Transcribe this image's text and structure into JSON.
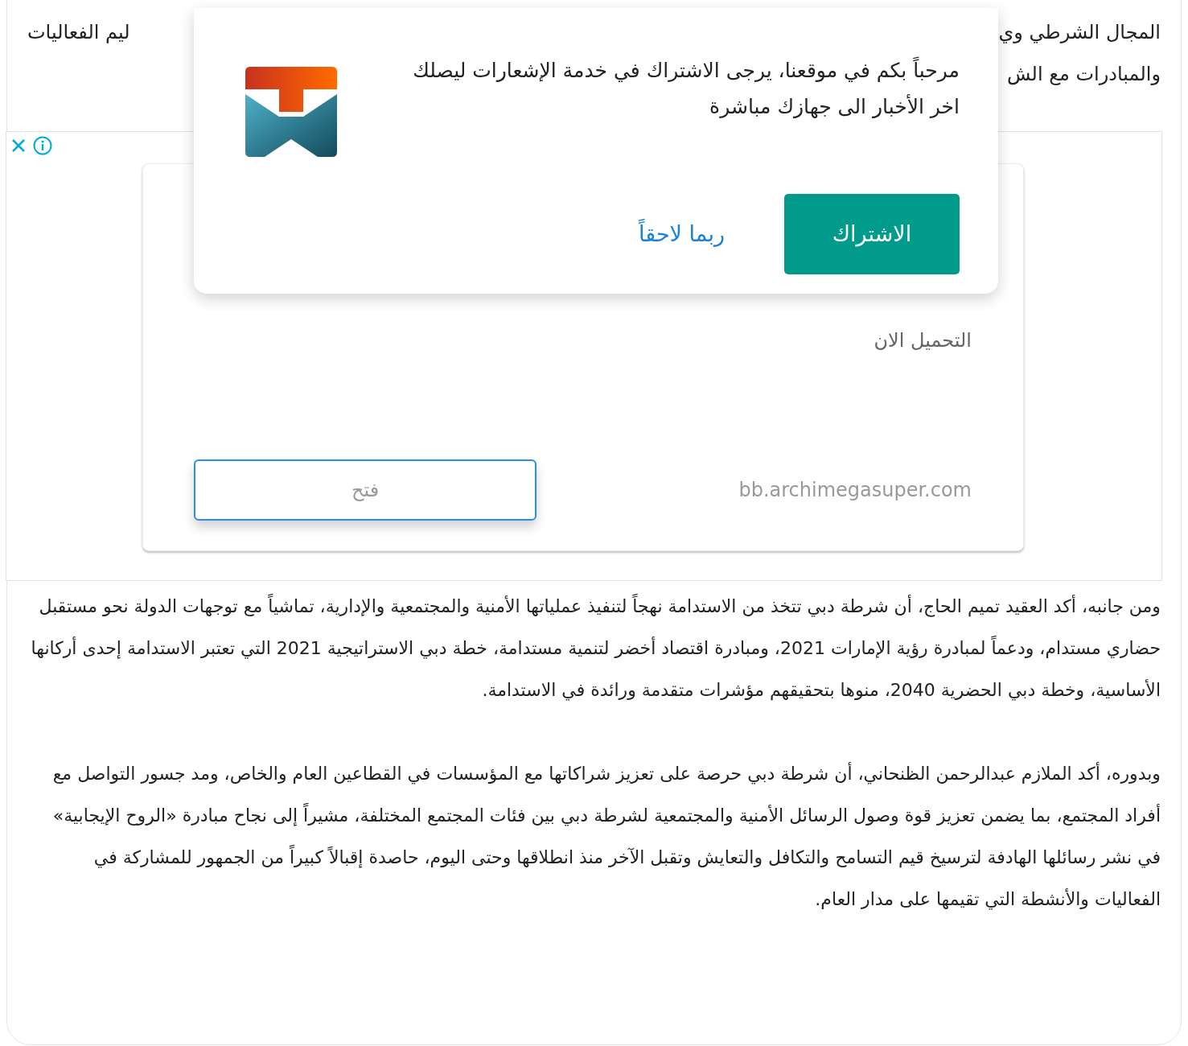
{
  "article_top": {
    "lines": [
      {
        "right": "المجال الشرطي وي",
        "left": "ليم الفعاليات"
      },
      {
        "right": "والمبادرات مع الش"
      }
    ]
  },
  "ad": {
    "headline": "التحميل الان",
    "domain": "bb.archimegasuper.com",
    "open_button": "فتح"
  },
  "popup": {
    "message": "مرحباً بكم في موقعنا، يرجى الاشتراك في خدمة الإشعارات ليصلك اخر الأخبار الى جهازك مباشرة",
    "subscribe_button": "الاشتراك",
    "later_button": "ربما لاحقاً"
  },
  "paragraphs": [
    "ومن جانبه، أكد العقيد تميم الحاج، أن شرطة دبي تتخذ من الاستدامة نهجاً لتنفيذ عملياتها الأمنية والمجتمعية والإدارية، تماشياً مع توجهات الدولة نحو مستقبل حضاري مستدام، ودعماً لمبادرة رؤية الإمارات 2021، ومبادرة اقتصاد أخضر لتنمية مستدامة، خطة دبي الاستراتيجية 2021 التي تعتبر الاستدامة إحدى أركانها الأساسية، وخطة دبي الحضرية 2040، منوها بتحقيقهم مؤشرات متقدمة ورائدة في الاستدامة.",
    "وبدوره، أكد الملازم عبدالرحمن الظنحاني، أن شرطة دبي حرصة على تعزيز شراكاتها مع المؤسسات في القطاعين العام والخاص، ومد جسور التواصل مع أفراد المجتمع، بما يضمن تعزيز قوة وصول الرسائل الأمنية والمجتمعية لشرطة دبي بين فئات المجتمع المختلفة، مشيراً إلى نجاح مبادرة «الروح الإيجابية» في نشر رسائلها الهادفة لترسيخ قيم التسامح والتكافل والتعايش وتقبل الآخر منذ انطلاقها وحتى اليوم، حاصدة إقبالاً كبيراً من الجمهور للمشاركة في الفعاليات والأنشطة التي تقيمها على مدار العام."
  ]
}
